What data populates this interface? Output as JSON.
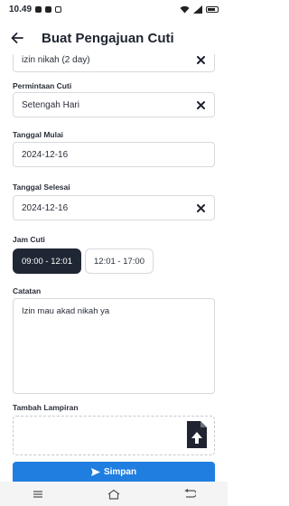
{
  "status_bar": {
    "time": "10.49",
    "battery": ""
  },
  "header": {
    "title": "Buat Pengajuan Cuti"
  },
  "fields": {
    "jenis_cuti_value": "izin nikah (2 day)",
    "permintaan_label": "Permintaan Cuti",
    "permintaan_value": "Setengah Hari",
    "mulai_label": "Tanggal Mulai",
    "mulai_value": "2024-12-16",
    "selesai_label": "Tanggal Selesai",
    "selesai_value": "2024-12-16",
    "jam_label": "Jam Cuti",
    "jam_options": [
      "09:00 - 12:01",
      "12:01 - 17:00"
    ],
    "catatan_label": "Catatan",
    "catatan_value": "Izin mau akad nikah ya",
    "lampiran_label": "Tambah Lampiran"
  },
  "actions": {
    "save_label": "Simpan"
  },
  "colors": {
    "primary": "#1f7ee0",
    "chip_active": "#202734"
  },
  "icons": [
    "arrow-left-icon",
    "close-icon",
    "file-upload-icon",
    "send-icon"
  ]
}
